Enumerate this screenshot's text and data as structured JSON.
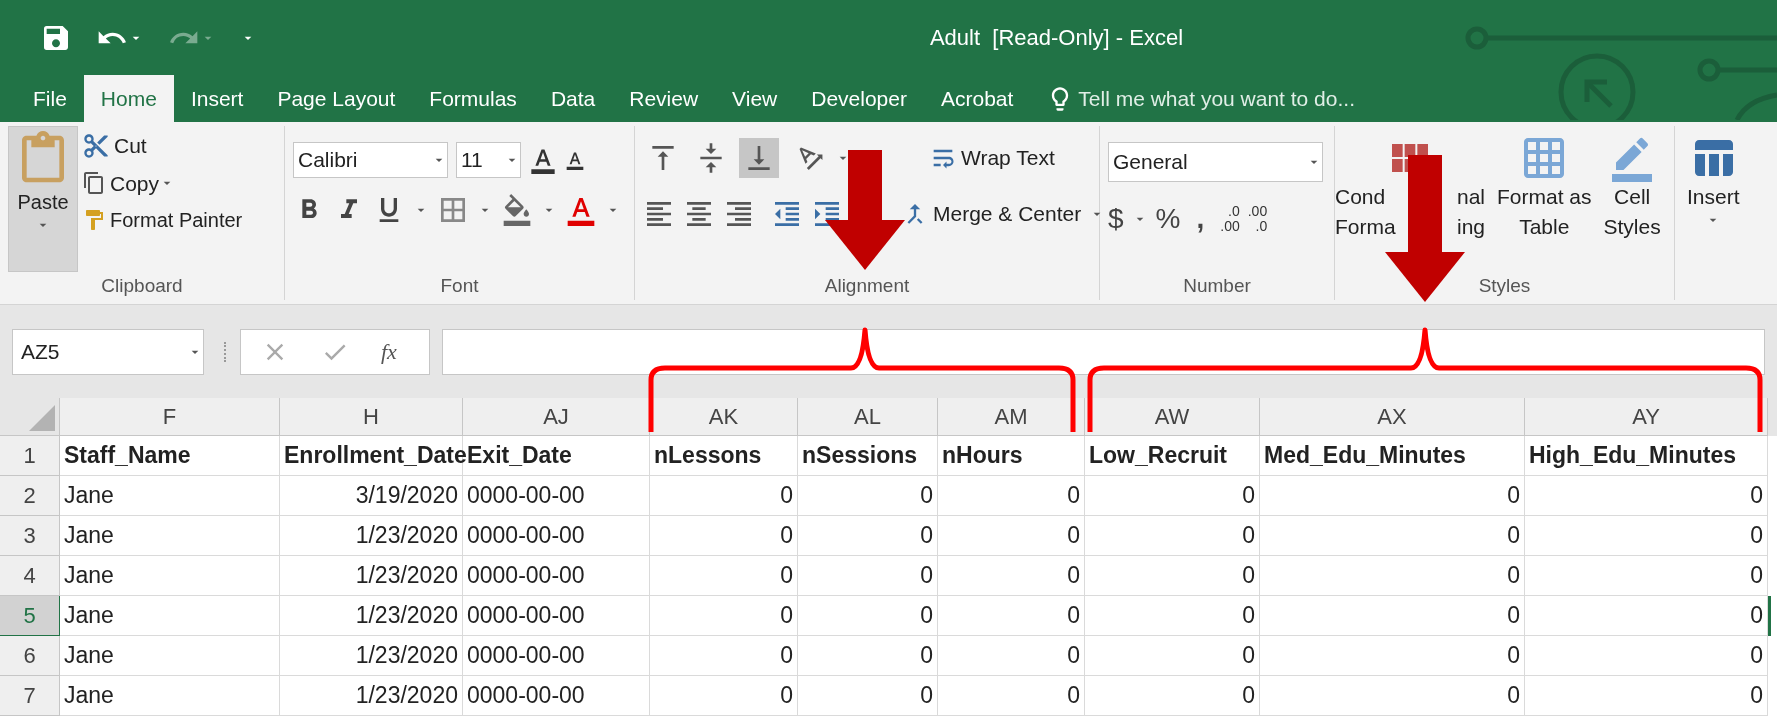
{
  "window": {
    "title": "Adult  [Read-Only] - Excel"
  },
  "tabs": [
    {
      "label": "File",
      "selected": false
    },
    {
      "label": "Home",
      "selected": true
    },
    {
      "label": "Insert",
      "selected": false
    },
    {
      "label": "Page Layout",
      "selected": false
    },
    {
      "label": "Formulas",
      "selected": false
    },
    {
      "label": "Data",
      "selected": false
    },
    {
      "label": "Review",
      "selected": false
    },
    {
      "label": "View",
      "selected": false
    },
    {
      "label": "Developer",
      "selected": false
    },
    {
      "label": "Acrobat",
      "selected": false
    }
  ],
  "tell_me": {
    "placeholder": "Tell me what you want to do..."
  },
  "ribbon": {
    "clipboard": {
      "label": "Clipboard",
      "paste": "Paste",
      "cut": "Cut",
      "copy": "Copy",
      "format_painter": "Format Painter"
    },
    "font": {
      "label": "Font",
      "font_name": "Calibri",
      "font_size": "11"
    },
    "alignment": {
      "label": "Alignment",
      "wrap_text": "Wrap Text",
      "merge_center": "Merge & Center",
      "vertical_align": [
        {
          "kind": "top",
          "selected": false
        },
        {
          "kind": "middle",
          "selected": false
        },
        {
          "kind": "bottom",
          "selected": true
        }
      ]
    },
    "number": {
      "label": "Number",
      "format": "General",
      "currency": "$",
      "percent": "%",
      "comma": ",",
      "decimals": [
        {
          "top": ".0",
          "bottom": ".00"
        },
        {
          "top": ".00",
          "bottom": ".0"
        }
      ]
    },
    "styles": {
      "label": "Styles",
      "conditional_formatting": [
        "Cond",
        "nal",
        "Forma",
        "ing"
      ],
      "format_as_table": [
        "Format as",
        "Table"
      ],
      "cell_styles": [
        "Cell",
        "Styles"
      ]
    },
    "cells": {
      "insert": "Insert"
    }
  },
  "formula_bar": {
    "name_box": "AZ5",
    "function_label": "fx"
  },
  "sheet": {
    "columns": [
      {
        "letter": "F",
        "numeric": false
      },
      {
        "letter": "H",
        "numeric": true
      },
      {
        "letter": "AJ",
        "numeric": false
      },
      {
        "letter": "AK",
        "numeric": true
      },
      {
        "letter": "AL",
        "numeric": true
      },
      {
        "letter": "AM",
        "numeric": true
      },
      {
        "letter": "AW",
        "numeric": true
      },
      {
        "letter": "AX",
        "numeric": true
      },
      {
        "letter": "AY",
        "numeric": true
      }
    ],
    "rows": [
      {
        "number": "1",
        "kind": "header",
        "selected": false,
        "cells": [
          "Staff_Name",
          "Enrollment_Date",
          "Exit_Date",
          "nLessons",
          "nSessions",
          "nHours",
          "Low_Recruit",
          "Med_Edu_Minutes",
          "High_Edu_Minutes"
        ]
      },
      {
        "number": "2",
        "kind": "data",
        "selected": false,
        "cells": [
          "Jane",
          "3/19/2020",
          "0000-00-00",
          "0",
          "0",
          "0",
          "0",
          "0",
          "0"
        ]
      },
      {
        "number": "3",
        "kind": "data",
        "selected": false,
        "cells": [
          "Jane",
          "1/23/2020",
          "0000-00-00",
          "0",
          "0",
          "0",
          "0",
          "0",
          "0"
        ]
      },
      {
        "number": "4",
        "kind": "data",
        "selected": false,
        "cells": [
          "Jane",
          "1/23/2020",
          "0000-00-00",
          "0",
          "0",
          "0",
          "0",
          "0",
          "0"
        ]
      },
      {
        "number": "5",
        "kind": "data",
        "selected": true,
        "cells": [
          "Jane",
          "1/23/2020",
          "0000-00-00",
          "0",
          "0",
          "0",
          "0",
          "0",
          "0"
        ]
      },
      {
        "number": "6",
        "kind": "data",
        "selected": false,
        "cells": [
          "Jane",
          "1/23/2020",
          "0000-00-00",
          "0",
          "0",
          "0",
          "0",
          "0",
          "0"
        ]
      },
      {
        "number": "7",
        "kind": "data",
        "selected": false,
        "cells": [
          "Jane",
          "1/23/2020",
          "0000-00-00",
          "0",
          "0",
          "0",
          "0",
          "0",
          "0"
        ]
      }
    ]
  }
}
